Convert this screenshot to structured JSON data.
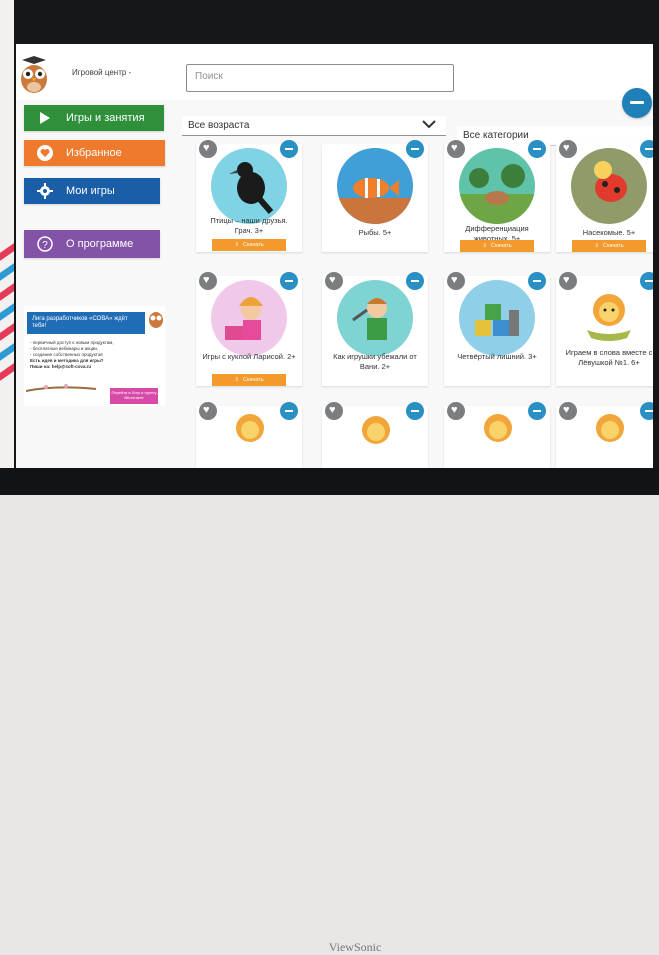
{
  "app": {
    "title": "Игровой центр -",
    "search_placeholder": "Поиск",
    "device_brand": "ViewSonic"
  },
  "nav": {
    "games": "Игры и занятия",
    "favorites": "Избранное",
    "my_games": "Мои игры",
    "about": "О программе"
  },
  "promo": {
    "headline": "Лига разработчиков «СОВА» ждёт тебя!",
    "lines": [
      "- первичный доступ к новым продуктам,",
      "- бесплатные вебинары и акции,",
      "- создание собственных продуктов",
      "Есть идея и методика для игры?",
      "Пиши на: help@soft-cova.ru"
    ],
    "button": "Перейти в Лигу и группу ВКонтакте"
  },
  "filters": {
    "age": "Все возраста",
    "category": "Все категории"
  },
  "download_label": "Скачать",
  "cards": [
    {
      "title": "Птицы – наши друзья. Грач. 3+",
      "image": "crow"
    },
    {
      "title": "Рыбы. 5+",
      "image": "fish"
    },
    {
      "title": "Дифференциация животных. 5+",
      "image": "animals"
    },
    {
      "title": "Насекомые. 5+",
      "image": "ladybug"
    },
    {
      "title": "Игры с куклой Ларисой. 2+",
      "image": "doll"
    },
    {
      "title": "Как игрушки убежали от Вани. 2+",
      "image": "boy"
    },
    {
      "title": "Четвёртый лишний. 3+",
      "image": "blocks"
    },
    {
      "title": "Играем в слова вместе с Лёвушкой №1. 6+",
      "image": "lion"
    }
  ],
  "colors": {
    "games": "#2f8f3a",
    "favorites": "#ef7a2d",
    "my_games": "#1b5ea8",
    "about": "#8353a7",
    "accent": "#1f80b7",
    "download": "#f39a2c"
  }
}
